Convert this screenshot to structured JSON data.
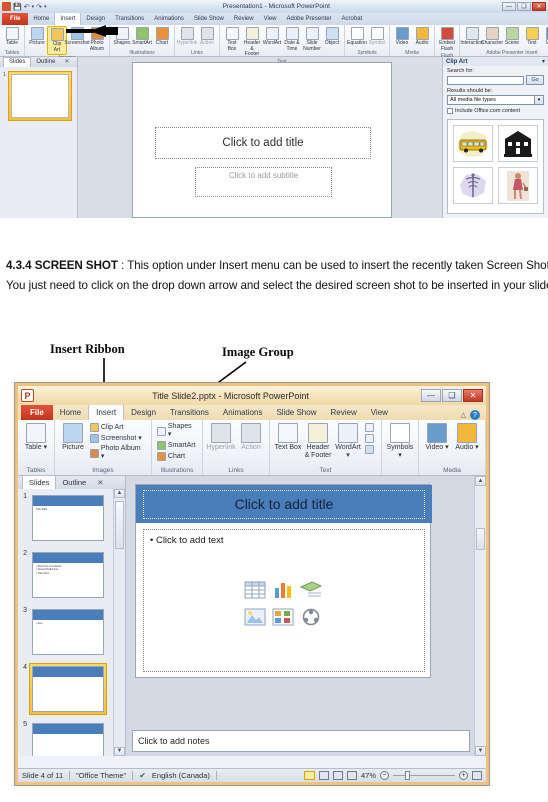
{
  "page": {
    "body_paragraph_prefix": "4.3.4 SCREEN SHOT",
    "body_paragraph_rest": " : This option under Insert menu can be used to insert the recently taken Screen Shots. You just need to click on the drop down arrow and select the desired screen shot to be inserted in your slide."
  },
  "callouts": {
    "insert_ribbon": "Insert Ribbon",
    "image_group": "Image Group"
  },
  "shot1": {
    "window_title": "Presentation1 - Microsoft PowerPoint",
    "win_buttons": {
      "minimize": "—",
      "maximize": "❑",
      "close": "✕"
    },
    "tabs": [
      {
        "label": "File",
        "state": "file"
      },
      {
        "label": "Home",
        "state": "normal"
      },
      {
        "label": "Insert",
        "state": "active"
      },
      {
        "label": "Design",
        "state": "normal"
      },
      {
        "label": "Transitions",
        "state": "normal"
      },
      {
        "label": "Animations",
        "state": "normal"
      },
      {
        "label": "Slide Show",
        "state": "normal"
      },
      {
        "label": "Review",
        "state": "normal"
      },
      {
        "label": "View",
        "state": "normal"
      },
      {
        "label": "Adobe Presenter",
        "state": "normal"
      },
      {
        "label": "Acrobat",
        "state": "normal"
      }
    ],
    "groups": [
      {
        "label": "Tables",
        "buttons": [
          {
            "label": "Table",
            "icon": "table-icon",
            "dim": false
          }
        ]
      },
      {
        "label": "Images",
        "buttons": [
          {
            "label": "Picture",
            "icon": "picture-icon",
            "dim": false
          },
          {
            "label": "Clip Art",
            "icon": "clip-art-icon",
            "dim": false,
            "highlight": true
          },
          {
            "label": "Screenshot",
            "icon": "screenshot-icon",
            "dim": false
          },
          {
            "label": "Photo Album",
            "icon": "photo-album-icon",
            "dim": false
          }
        ]
      },
      {
        "label": "Illustrations",
        "buttons": [
          {
            "label": "Shapes",
            "icon": "shapes-icon",
            "dim": false
          },
          {
            "label": "SmartArt",
            "icon": "smartart-icon",
            "dim": false
          },
          {
            "label": "Chart",
            "icon": "chart-icon",
            "dim": false
          }
        ]
      },
      {
        "label": "Links",
        "buttons": [
          {
            "label": "Hyperlink",
            "icon": "hyperlink-icon",
            "dim": true
          },
          {
            "label": "Action",
            "icon": "action-icon",
            "dim": true
          }
        ]
      },
      {
        "label": "Text",
        "buttons": [
          {
            "label": "Text Box",
            "icon": "text-box-icon",
            "dim": false
          },
          {
            "label": "Header & Footer",
            "icon": "header-footer-icon",
            "dim": false
          },
          {
            "label": "WordArt",
            "icon": "wordart-icon",
            "dim": false
          },
          {
            "label": "Date & Time",
            "icon": "date-time-icon",
            "dim": false
          },
          {
            "label": "Slide Number",
            "icon": "slide-number-icon",
            "dim": false
          },
          {
            "label": "Object",
            "icon": "object-icon",
            "dim": false
          }
        ]
      },
      {
        "label": "Symbols",
        "buttons": [
          {
            "label": "Equation",
            "icon": "equation-icon",
            "dim": false
          },
          {
            "label": "Symbol",
            "icon": "symbol-icon",
            "dim": true
          }
        ]
      },
      {
        "label": "Media",
        "buttons": [
          {
            "label": "Video",
            "icon": "video-icon",
            "dim": false
          },
          {
            "label": "Audio",
            "icon": "audio-icon",
            "dim": false
          }
        ]
      },
      {
        "label": "Flash",
        "buttons": [
          {
            "label": "Embed Flash",
            "icon": "embed-flash-icon",
            "dim": false
          }
        ]
      },
      {
        "label": "Adobe Presenter Insert",
        "buttons": [
          {
            "label": "Interaction",
            "icon": "interaction-icon",
            "dim": false
          },
          {
            "label": "Character",
            "icon": "character-icon",
            "dim": false
          },
          {
            "label": "Scene",
            "icon": "scene-icon",
            "dim": false
          },
          {
            "label": "Text",
            "icon": "text-icon",
            "dim": false
          },
          {
            "label": "Video",
            "icon": "video2-icon",
            "dim": false
          }
        ]
      }
    ],
    "slide_tabs": {
      "slides": "Slides",
      "outline": "Outline",
      "close": "✕"
    },
    "slide_thumb_number": "1",
    "slide_placeholders": {
      "title": "Click to add title",
      "subtitle": "Click to add subtitle"
    },
    "clip_art_panel": {
      "title": "Clip Art",
      "collapse": "▾",
      "search_label": "Search for:",
      "search_value": "",
      "go_button": "Go",
      "results_label": "Results should be:",
      "results_value": "All media file types",
      "dropdown_arrow": "▾",
      "checkbox_label": "Include Office.com content",
      "checkbox_checked": false,
      "thumbnails": [
        {
          "name": "school-bus-clipart"
        },
        {
          "name": "school-building-clipart"
        },
        {
          "name": "caduceus-clipart"
        },
        {
          "name": "person-walking-clipart"
        }
      ]
    }
  },
  "shot2": {
    "window_title": "Title Slide2.pptx  -  Microsoft PowerPoint",
    "win_buttons": {
      "minimize": "—",
      "maximize": "❑",
      "close": "✕"
    },
    "help_icons": {
      "collapse_ribbon": "△",
      "help": "?"
    },
    "quick_access": {
      "save": "💾",
      "undo": "↶",
      "undo_menu": "▾",
      "redo": "↷",
      "customize": "▾"
    },
    "tabs": [
      {
        "label": "File",
        "state": "file"
      },
      {
        "label": "Home",
        "state": "normal"
      },
      {
        "label": "Insert",
        "state": "active"
      },
      {
        "label": "Design",
        "state": "normal"
      },
      {
        "label": "Transitions",
        "state": "normal"
      },
      {
        "label": "Animations",
        "state": "normal"
      },
      {
        "label": "Slide Show",
        "state": "normal"
      },
      {
        "label": "Review",
        "state": "normal"
      },
      {
        "label": "View",
        "state": "normal"
      }
    ],
    "groups": [
      {
        "label": "Tables",
        "big": [
          {
            "label": "Table",
            "icon": "table-icon",
            "dropdown": "▾",
            "dim": false
          }
        ],
        "small": []
      },
      {
        "label": "Images",
        "big": [
          {
            "label": "Picture",
            "icon": "picture-icon",
            "dim": false
          }
        ],
        "small": [
          {
            "label": "Clip Art",
            "icon": "clip-art-icon",
            "dropdown": ""
          },
          {
            "label": "Screenshot",
            "icon": "screenshot-icon",
            "dropdown": "▾"
          },
          {
            "label": "Photo Album",
            "icon": "photo-album-icon",
            "dropdown": "▾"
          }
        ]
      },
      {
        "label": "Illustrations",
        "big": [],
        "small": [
          {
            "label": "Shapes",
            "icon": "shapes-icon",
            "dropdown": "▾"
          },
          {
            "label": "SmartArt",
            "icon": "smartart-icon",
            "dropdown": ""
          },
          {
            "label": "Chart",
            "icon": "chart-icon",
            "dropdown": ""
          }
        ]
      },
      {
        "label": "Links",
        "big": [
          {
            "label": "Hyperlink",
            "icon": "hyperlink-icon",
            "dim": true
          },
          {
            "label": "Action",
            "icon": "action-icon",
            "dim": true
          }
        ],
        "small": []
      },
      {
        "label": "Text",
        "big": [
          {
            "label": "Text Box",
            "icon": "text-box-icon",
            "dim": false
          },
          {
            "label": "Header & Footer",
            "icon": "header-footer-icon",
            "dim": false
          },
          {
            "label": "WordArt",
            "icon": "wordart-icon",
            "dropdown": "▾",
            "dim": false
          }
        ],
        "small": [
          {
            "label": "",
            "icon": "date-time-icon",
            "dropdown": ""
          },
          {
            "label": "",
            "icon": "slide-number-icon",
            "dropdown": ""
          },
          {
            "label": "",
            "icon": "object-icon",
            "dropdown": ""
          }
        ]
      },
      {
        "label": "",
        "big": [
          {
            "label": "Symbols",
            "icon": "symbol-icon",
            "dropdown": "▾",
            "dim": false
          }
        ],
        "small": []
      },
      {
        "label": "Media",
        "big": [
          {
            "label": "Video",
            "icon": "video-icon",
            "dropdown": "▾",
            "dim": false
          },
          {
            "label": "Audio",
            "icon": "audio-icon",
            "dropdown": "▾",
            "dim": false
          }
        ],
        "small": []
      }
    ],
    "slide_tabs": {
      "slides": "Slides",
      "outline": "Outline",
      "close": "✕"
    },
    "thumbnails": [
      {
        "number": "1",
        "selected": false,
        "lines": [
          "Title Slide"
        ]
      },
      {
        "number": "2",
        "selected": false,
        "lines": [
          "• Short list of contents",
          "• Second bullet line",
          "• Third item"
        ]
      },
      {
        "number": "3",
        "selected": false,
        "lines": [
          "• Item"
        ]
      },
      {
        "number": "4",
        "selected": true,
        "lines": []
      },
      {
        "number": "5",
        "selected": false,
        "lines": []
      }
    ],
    "slide_placeholders": {
      "title": "Click to add title",
      "body": "• Click to add text",
      "content_icons": [
        {
          "name": "insert-table-icon"
        },
        {
          "name": "insert-chart-icon"
        },
        {
          "name": "insert-smartart-icon"
        },
        {
          "name": "insert-picture-icon"
        },
        {
          "name": "insert-clip-art-icon"
        },
        {
          "name": "insert-media-clip-icon"
        }
      ]
    },
    "notes_placeholder": "Click to add notes",
    "status": {
      "slide_counter": "Slide 4 of 11",
      "theme": "\"Office Theme\"",
      "spellcheck_icon": "spell-check-icon",
      "language": "English (Canada)",
      "view_normal": "view-normal-icon",
      "view_sorter": "view-slide-sorter-icon",
      "view_reading": "view-reading-icon",
      "view_slideshow": "view-slideshow-icon",
      "zoom_level": "47%",
      "zoom_out": "−",
      "zoom_in": "+",
      "fit_to_window": "fit-slide-to-window-icon"
    }
  },
  "colors": {
    "ppt_orange": "#c0351c",
    "title_band_blue": "#4a7ebb",
    "selected_thumb": "#f5bf3f",
    "highlight_yellow": "#ffeb9c"
  }
}
